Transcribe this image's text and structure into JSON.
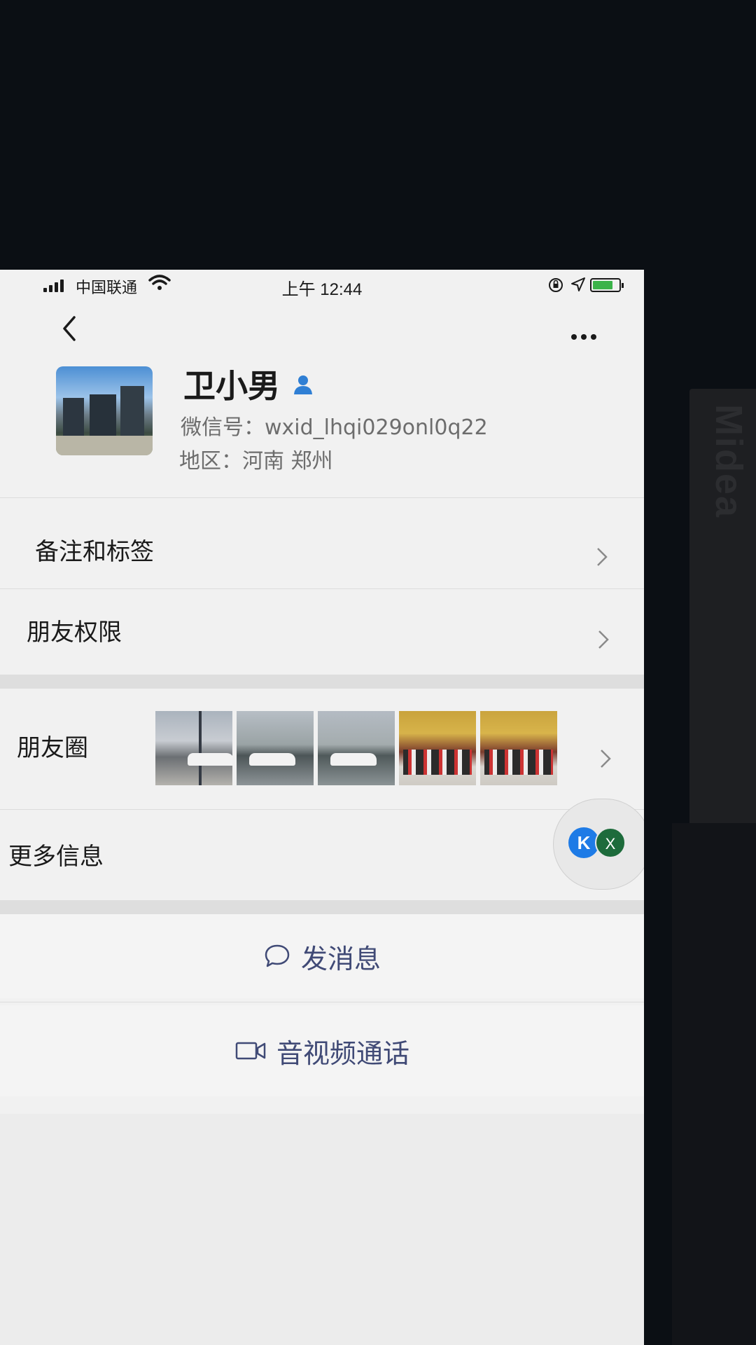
{
  "status_bar": {
    "carrier": "中国联通",
    "time": "上午 12:44"
  },
  "profile": {
    "name": "卫小男",
    "wxid_label": "微信号：",
    "wxid": "wxid_lhqi029onl0q22",
    "region_label": "地区：",
    "region": "河南 郑州"
  },
  "menu": {
    "remarks_tags": "备注和标签",
    "friend_permissions": "朋友权限",
    "moments": "朋友圈",
    "more_info": "更多信息"
  },
  "actions": {
    "send_message": "发消息",
    "video_call": "音视频通话"
  },
  "floating_apps": {
    "k_label": "K",
    "x_label": "X"
  },
  "background": {
    "side_text": "Midea"
  },
  "colors": {
    "action_text": "#404a76",
    "badge_blue": "#2f7fd4",
    "battery_green": "#3bb34a"
  }
}
